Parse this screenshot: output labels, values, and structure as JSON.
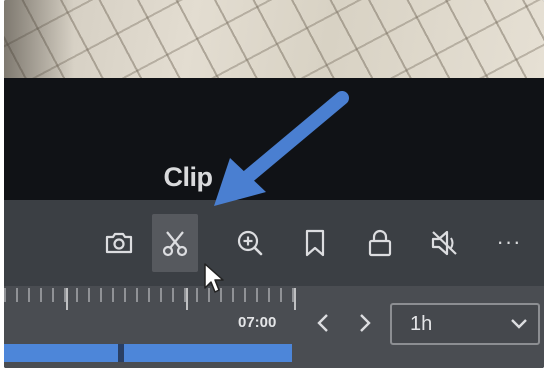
{
  "tooltip": {
    "text": "Clip"
  },
  "toolbar": {
    "items": [
      {
        "name": "snapshot",
        "icon": "camera-icon"
      },
      {
        "name": "clip",
        "icon": "scissors-icon",
        "active": true
      },
      {
        "name": "zoom",
        "icon": "zoom-in-icon"
      },
      {
        "name": "bookmark",
        "icon": "bookmark-icon"
      },
      {
        "name": "lock",
        "icon": "lock-icon"
      },
      {
        "name": "audio",
        "icon": "speaker-mute-icon"
      },
      {
        "name": "more",
        "icon": "more-icon",
        "label": "···"
      }
    ]
  },
  "timeline": {
    "time_label": "07:00",
    "range": {
      "value": "1h"
    }
  },
  "annotation": {
    "color": "#4a7fd1",
    "icon": "arrow-icon"
  },
  "colors": {
    "toolbar_bg": "#3b3f44",
    "active_tool_bg": "#56595e",
    "recording_bar": "#4d86d9",
    "overlay_bg": "#101216"
  }
}
